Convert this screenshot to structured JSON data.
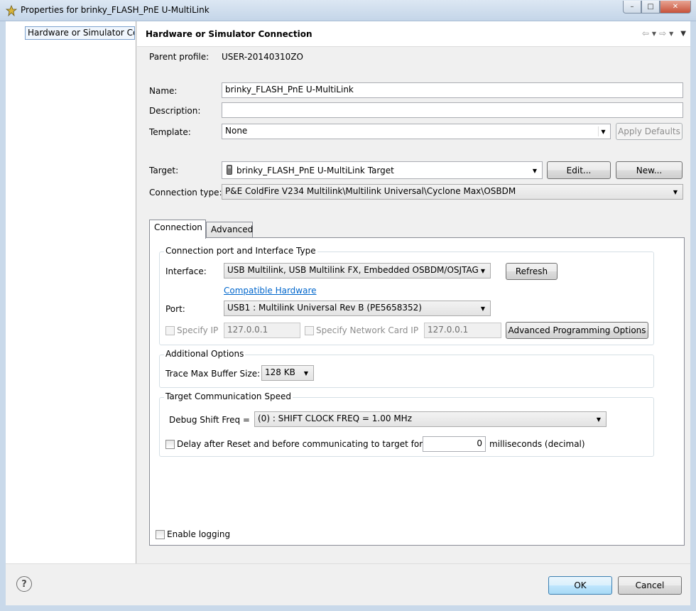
{
  "window": {
    "title": "Properties for brinky_FLASH_PnE U-MultiLink",
    "minimize": "–",
    "maximize": "□",
    "close": "✕"
  },
  "tree": {
    "selected_item": "Hardware or Simulator Connection"
  },
  "page": {
    "title": "Hardware or Simulator Connection"
  },
  "form": {
    "parent_profile_label": "Parent profile:",
    "parent_profile_value": "USER-20140310ZO",
    "name_label": "Name:",
    "name_value": "brinky_FLASH_PnE U-MultiLink",
    "description_label": "Description:",
    "description_value": "",
    "template_label": "Template:",
    "template_value": "None",
    "apply_defaults": "Apply Defaults",
    "target_label": "Target:",
    "target_value": "brinky_FLASH_PnE U-MultiLink Target",
    "edit_button": "Edit...",
    "new_button": "New...",
    "connection_type_label": "Connection type:",
    "connection_type_value": "P&E ColdFire V234 Multilink\\Multilink Universal\\Cyclone Max\\OSBDM"
  },
  "tabs": [
    {
      "label": "Connection",
      "active": true
    },
    {
      "label": "Advanced",
      "active": false
    }
  ],
  "connection_group": {
    "title": "Connection port and Interface Type",
    "interface_label": "Interface:",
    "interface_value": "USB Multilink, USB Multilink FX, Embedded OSBDM/OSJTAG",
    "refresh_button": "Refresh",
    "compatible_link": "Compatible Hardware",
    "port_label": "Port:",
    "port_value": "USB1 : Multilink Universal Rev B (PE5658352)",
    "specify_ip_label": "Specify IP",
    "ip_value": "127.0.0.1",
    "specify_netcard_label": "Specify Network Card IP",
    "netcard_ip_value": "127.0.0.1",
    "advanced_programming_button": "Advanced Programming Options"
  },
  "additional_group": {
    "title": "Additional Options",
    "trace_label": "Trace Max Buffer Size:",
    "trace_value": "128 KB"
  },
  "speed_group": {
    "title": "Target Communication Speed",
    "debug_shift_label": "Debug Shift Freq =",
    "debug_shift_value": "(0) : SHIFT CLOCK FREQ = 1.00 MHz",
    "delay_label": "Delay after Reset and before communicating to target for",
    "delay_value": "0",
    "delay_unit": "milliseconds (decimal)"
  },
  "enable_logging_label": "Enable logging",
  "footer": {
    "ok": "OK",
    "cancel": "Cancel",
    "help": "?"
  }
}
